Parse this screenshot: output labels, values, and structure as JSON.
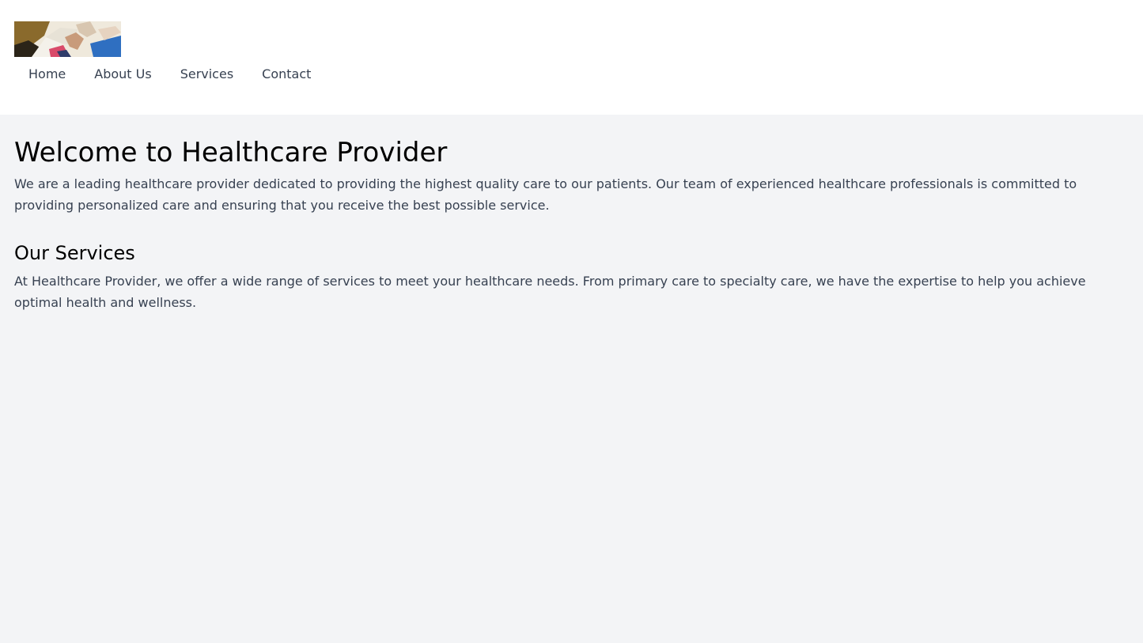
{
  "header": {
    "logo_icon": "healthcare-photo-logo",
    "nav": [
      {
        "label": "Home"
      },
      {
        "label": "About Us"
      },
      {
        "label": "Services"
      },
      {
        "label": "Contact"
      }
    ]
  },
  "main": {
    "welcome": {
      "title": "Welcome to Healthcare Provider",
      "text": "We are a leading healthcare provider dedicated to providing the highest quality care to our patients. Our team of experienced healthcare professionals is committed to providing personalized care and ensuring that you receive the best possible service."
    },
    "services": {
      "title": "Our Services",
      "text": "At Healthcare Provider, we offer a wide range of services to meet your healthcare needs. From primary care to specialty care, we have the expertise to help you achieve optimal health and wellness."
    }
  },
  "colors": {
    "page_background": "#f3f4f6",
    "header_background": "#ffffff",
    "body_text": "#374151",
    "heading_text": "#000000"
  }
}
